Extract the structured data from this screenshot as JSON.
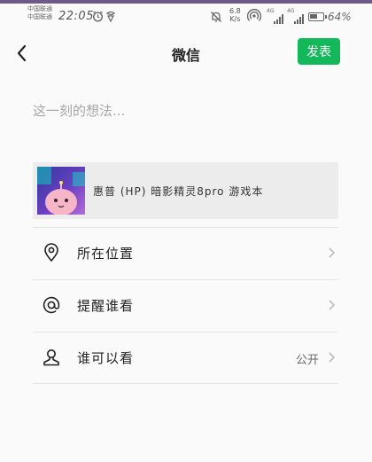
{
  "status_bar": {
    "carrier_1": "中国联通",
    "carrier_2": "中国联通",
    "time": "22:05",
    "net_speed_value": "6.8",
    "net_speed_unit": "K/s",
    "network_type_1": "4G",
    "network_type_2": "4G",
    "battery_percent": "64%",
    "battery_level": 0.64,
    "icons": [
      "alarm-icon",
      "notification-icon",
      "mute-icon",
      "hotspot-icon",
      "signal-icon",
      "signal-icon",
      "battery-icon"
    ]
  },
  "header": {
    "title": "微信",
    "publish_label": "发表"
  },
  "compose": {
    "placeholder": "这一刻的想法..."
  },
  "shared_item": {
    "text": "惠普 (HP) 暗影精灵8pro 游戏本"
  },
  "options": [
    {
      "label": "所在位置",
      "value": "",
      "icon": "location-pin-icon"
    },
    {
      "label": "提醒谁看",
      "value": "",
      "icon": "at-mention-icon"
    },
    {
      "label": "谁可以看",
      "value": "公开",
      "icon": "person-icon"
    }
  ],
  "colors": {
    "accent": "#12b85a",
    "background": "#fafafa",
    "card_background": "#ececec",
    "top_strip": "#6e5a86"
  }
}
